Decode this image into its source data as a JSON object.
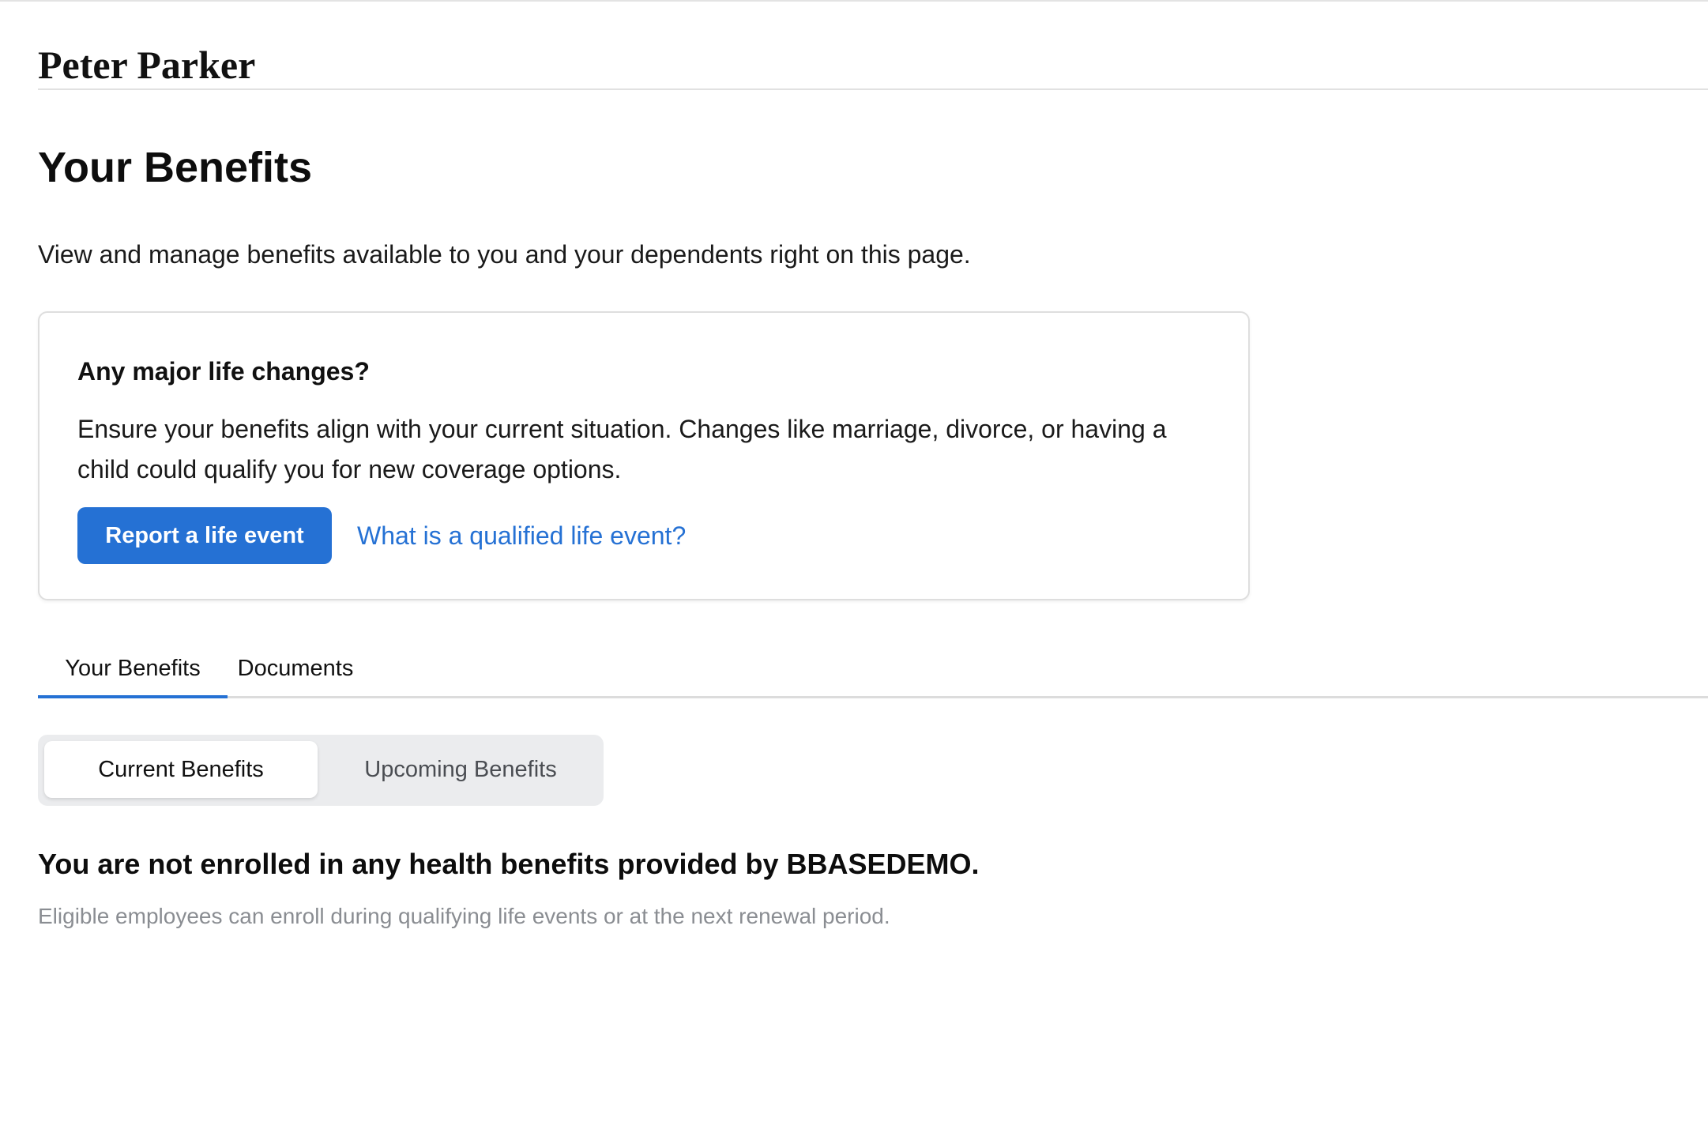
{
  "header": {
    "user_name": "Peter Parker"
  },
  "page": {
    "title": "Your Benefits",
    "subtitle": "View and manage benefits available to you and your dependents right on this page."
  },
  "life_changes": {
    "heading": "Any major life changes?",
    "body": "Ensure your benefits align with your current situation. Changes like marriage, divorce, or having a child could qualify you for new coverage options.",
    "report_button_label": "Report a life event",
    "help_link_label": "What is a qualified life event?"
  },
  "tabs": [
    {
      "label": "Your Benefits",
      "active": true
    },
    {
      "label": "Documents",
      "active": false
    }
  ],
  "benefit_toggle": [
    {
      "label": "Current Benefits",
      "selected": true
    },
    {
      "label": "Upcoming Benefits",
      "selected": false
    }
  ],
  "empty_state": {
    "heading": "You are not enrolled in any health benefits provided by BBASEDEMO.",
    "note": "Eligible employees can enroll during qualifying life events or at the next renewal period."
  },
  "colors": {
    "accent": "#2571d4",
    "muted_text": "#8a8d92",
    "toggle_background": "#ebecee"
  }
}
